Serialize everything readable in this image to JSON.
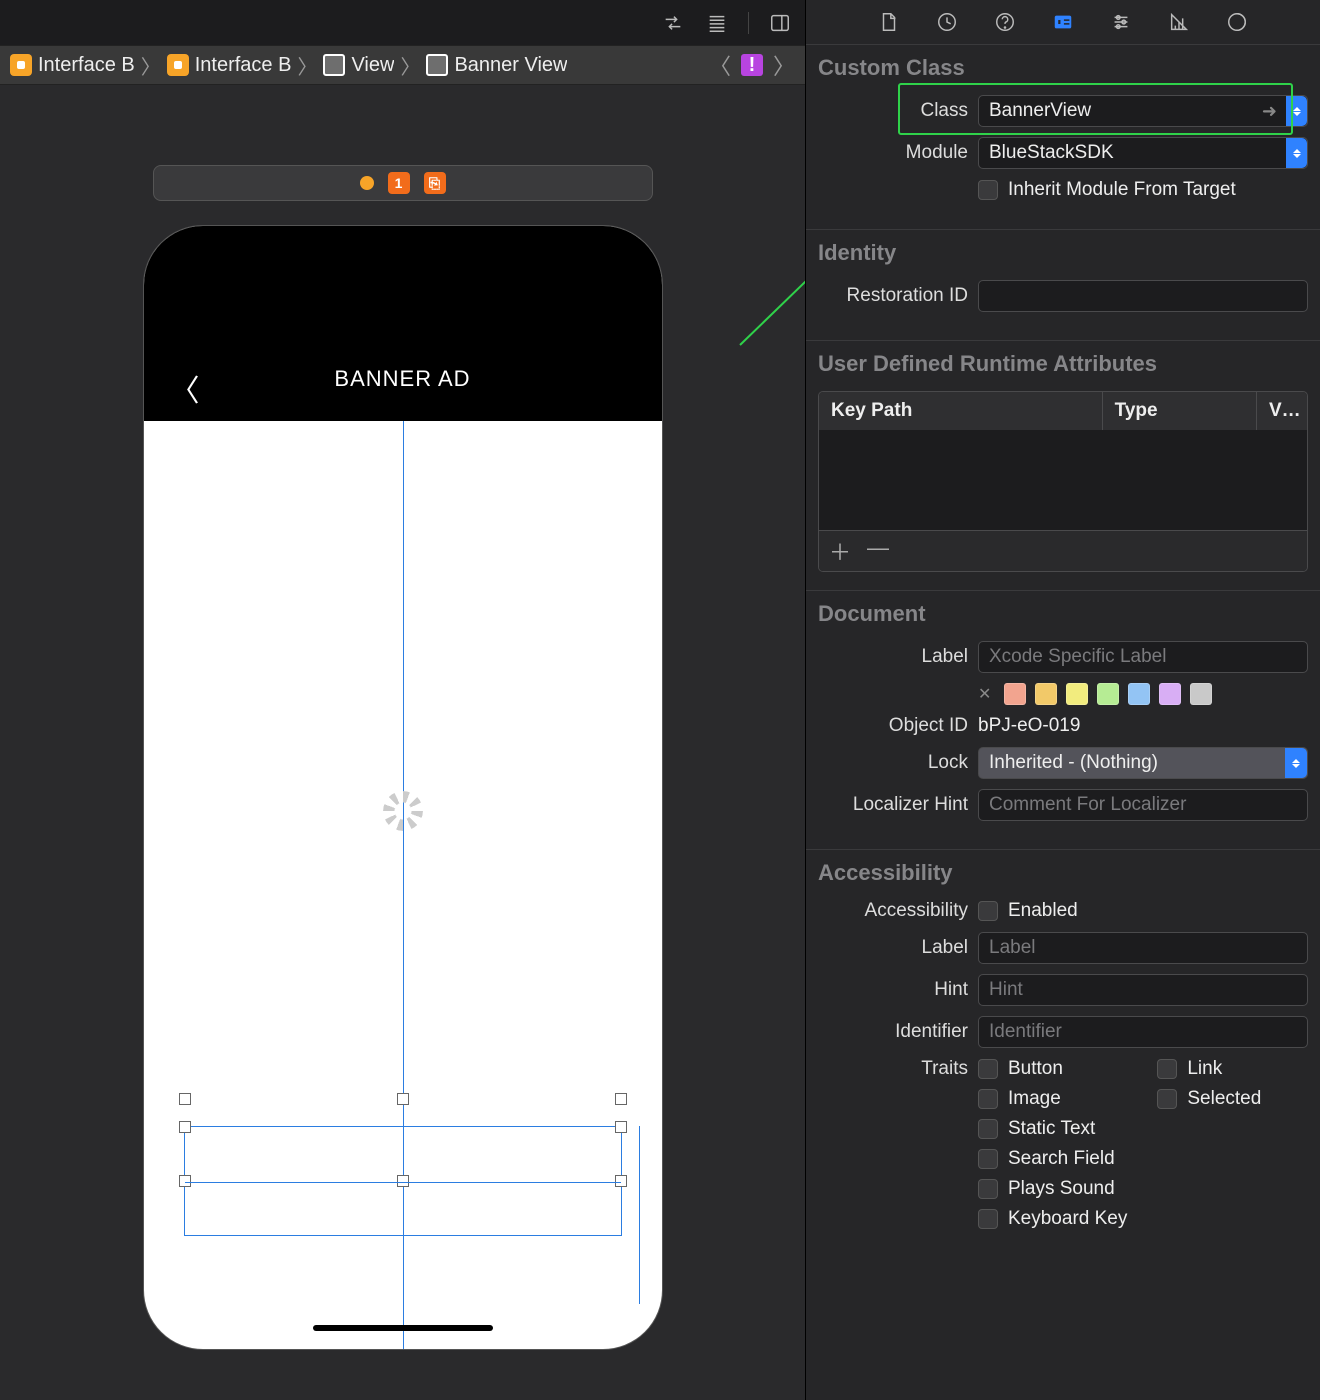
{
  "breadcrumb": {
    "items": [
      "Interface B",
      "Interface B",
      "View",
      "Banner View"
    ]
  },
  "scene_toolbar": {
    "badge1": "1"
  },
  "phone": {
    "title": "BANNER AD"
  },
  "inspector": {
    "sections": {
      "custom_class": {
        "title": "Custom Class",
        "class_label": "Class",
        "class_value": "BannerView",
        "module_label": "Module",
        "module_value": "BlueStackSDK",
        "inherit_label": "Inherit Module From Target"
      },
      "identity": {
        "title": "Identity",
        "restoration_label": "Restoration ID"
      },
      "runtime_attrs": {
        "title": "User Defined Runtime Attributes",
        "columns": [
          "Key Path",
          "Type",
          "V…"
        ]
      },
      "document": {
        "title": "Document",
        "label_label": "Label",
        "label_placeholder": "Xcode Specific Label",
        "object_id_label": "Object ID",
        "object_id_value": "bPJ-eO-019",
        "lock_label": "Lock",
        "lock_value": "Inherited - (Nothing)",
        "localizer_label": "Localizer Hint",
        "localizer_placeholder": "Comment For Localizer",
        "swatches": [
          "#f2a48f",
          "#f2c969",
          "#f2ec7e",
          "#b6ec94",
          "#93c4f4",
          "#d8aef4",
          "#c9c9c9"
        ]
      },
      "accessibility": {
        "title": "Accessibility",
        "a11y_label": "Accessibility",
        "enabled_label": "Enabled",
        "label_label": "Label",
        "label_placeholder": "Label",
        "hint_label": "Hint",
        "hint_placeholder": "Hint",
        "identifier_label": "Identifier",
        "identifier_placeholder": "Identifier",
        "traits_label": "Traits",
        "traits_col1": [
          "Button",
          "Image",
          "Static Text",
          "Search Field",
          "Plays Sound",
          "Keyboard Key"
        ],
        "traits_col2": [
          "Link",
          "Selected"
        ]
      }
    }
  }
}
